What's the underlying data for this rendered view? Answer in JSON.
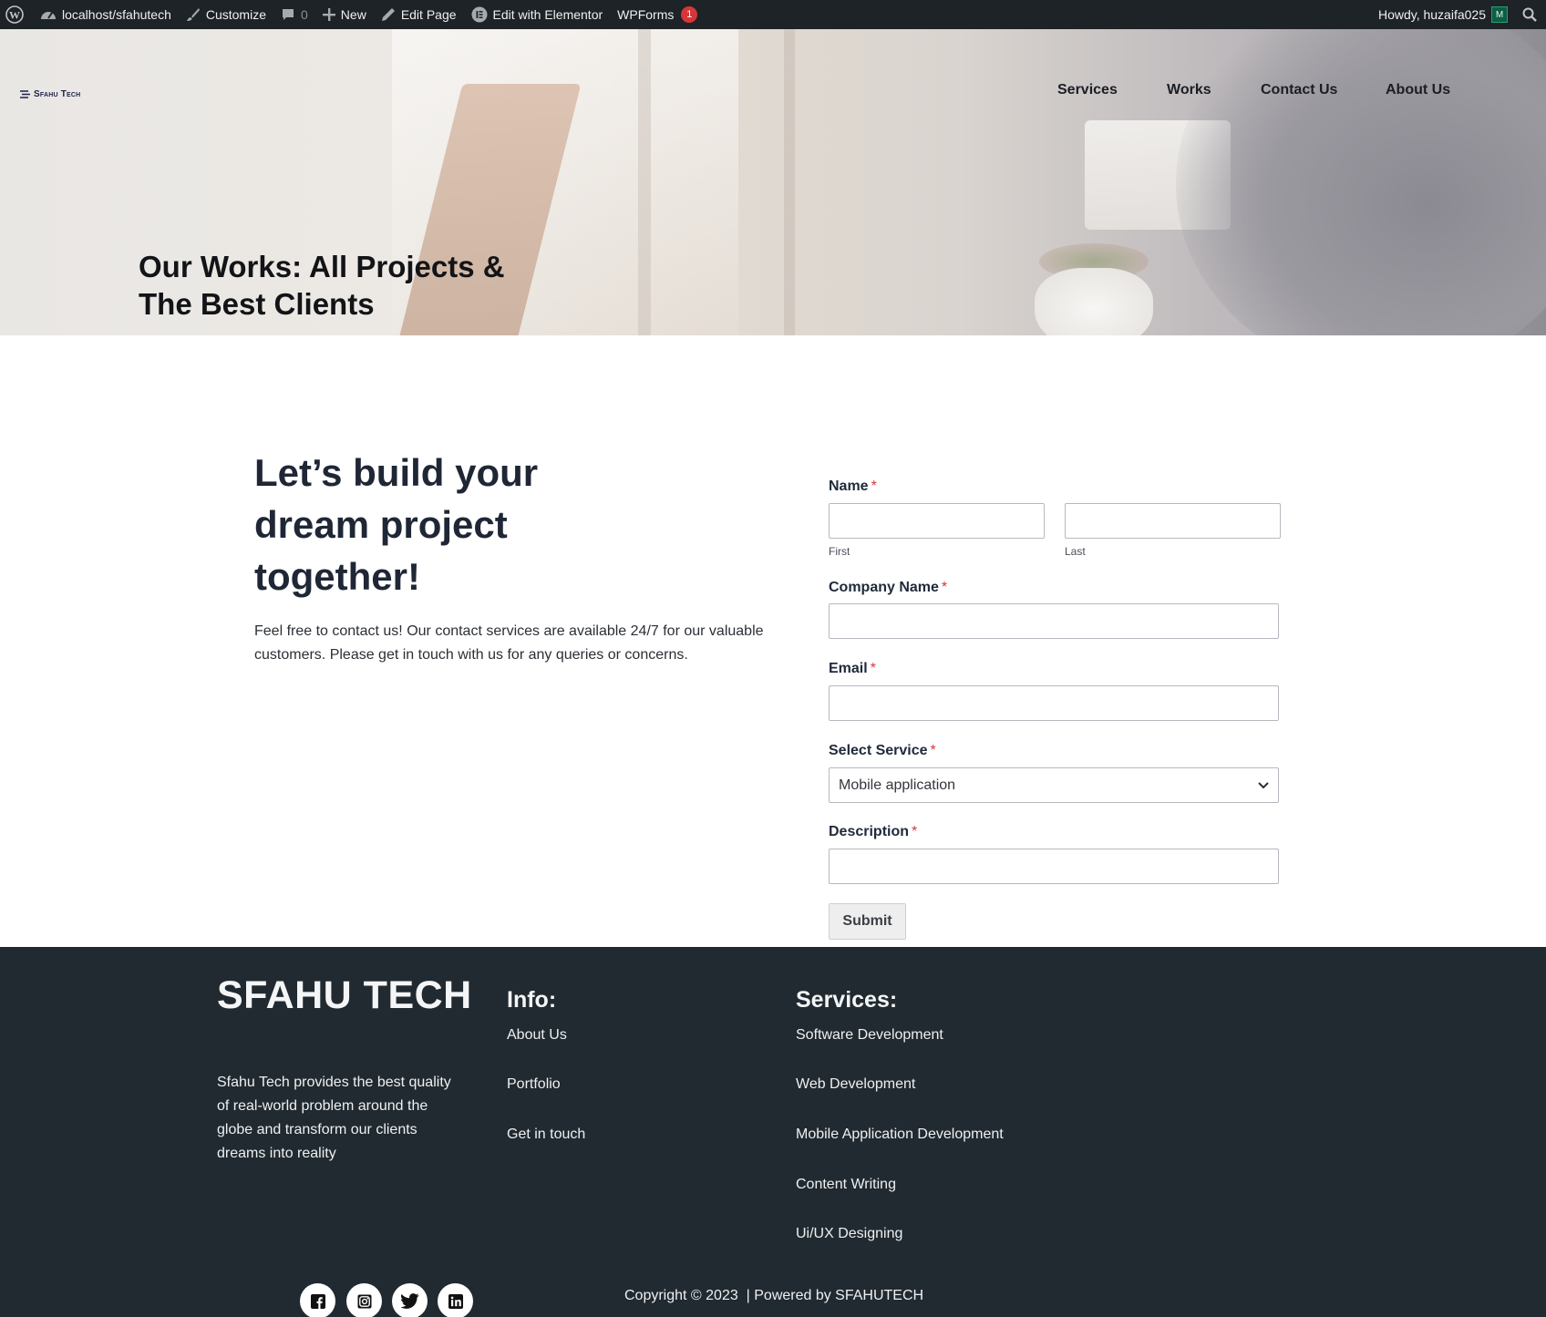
{
  "adminbar": {
    "site": "localhost/sfahutech",
    "customize": "Customize",
    "comments_count": "0",
    "new": "New",
    "edit_page": "Edit Page",
    "elementor": "Edit with Elementor",
    "wpforms": "WPForms",
    "wpforms_badge": "1",
    "howdy": "Howdy, huzaifa025",
    "avatar_initial": "M"
  },
  "header": {
    "logo_text": "Sfahu Tech",
    "nav": [
      "Services",
      "Works",
      "Contact Us",
      "About Us"
    ]
  },
  "hero": {
    "title": "Our Works: All Projects & The Best Clients"
  },
  "content": {
    "heading": "Let’s build your dream project together!",
    "intro": "Feel free to contact us! Our contact services are available 24/7 for our valuable customers. Please get in touch with us for any queries or concerns."
  },
  "form": {
    "name_label": "Name",
    "required_mark": "*",
    "first_sublabel": "First",
    "last_sublabel": "Last",
    "first_value": "",
    "last_value": "",
    "company_label": "Company Name",
    "company_value": "",
    "email_label": "Email",
    "email_value": "",
    "service_label": "Select Service",
    "service_selected": "Mobile application",
    "description_label": "Description",
    "description_value": "",
    "submit_label": "Submit"
  },
  "footer": {
    "brand": "SFAHU TECH",
    "description": "Sfahu Tech provides the best quality of real-world problem around the globe and transform our clients dreams into reality",
    "info_title": "Info:",
    "info_links": [
      "About Us",
      "Portfolio",
      "Get in touch"
    ],
    "services_title": "Services:",
    "services_links": [
      "Software Development",
      "Web Development",
      "Mobile Application Development",
      "Content Writing",
      "Ui/UX Designing"
    ],
    "social_icons": [
      "facebook-icon",
      "instagram-icon",
      "twitter-icon",
      "linkedin-icon"
    ],
    "copyright": "Copyright © 2023  | Powered by SFAHUTECH"
  },
  "colors": {
    "adminbar_bg": "#1d2327",
    "footer_bg": "#212a30",
    "required": "#d63638",
    "heading": "#1f2736"
  }
}
